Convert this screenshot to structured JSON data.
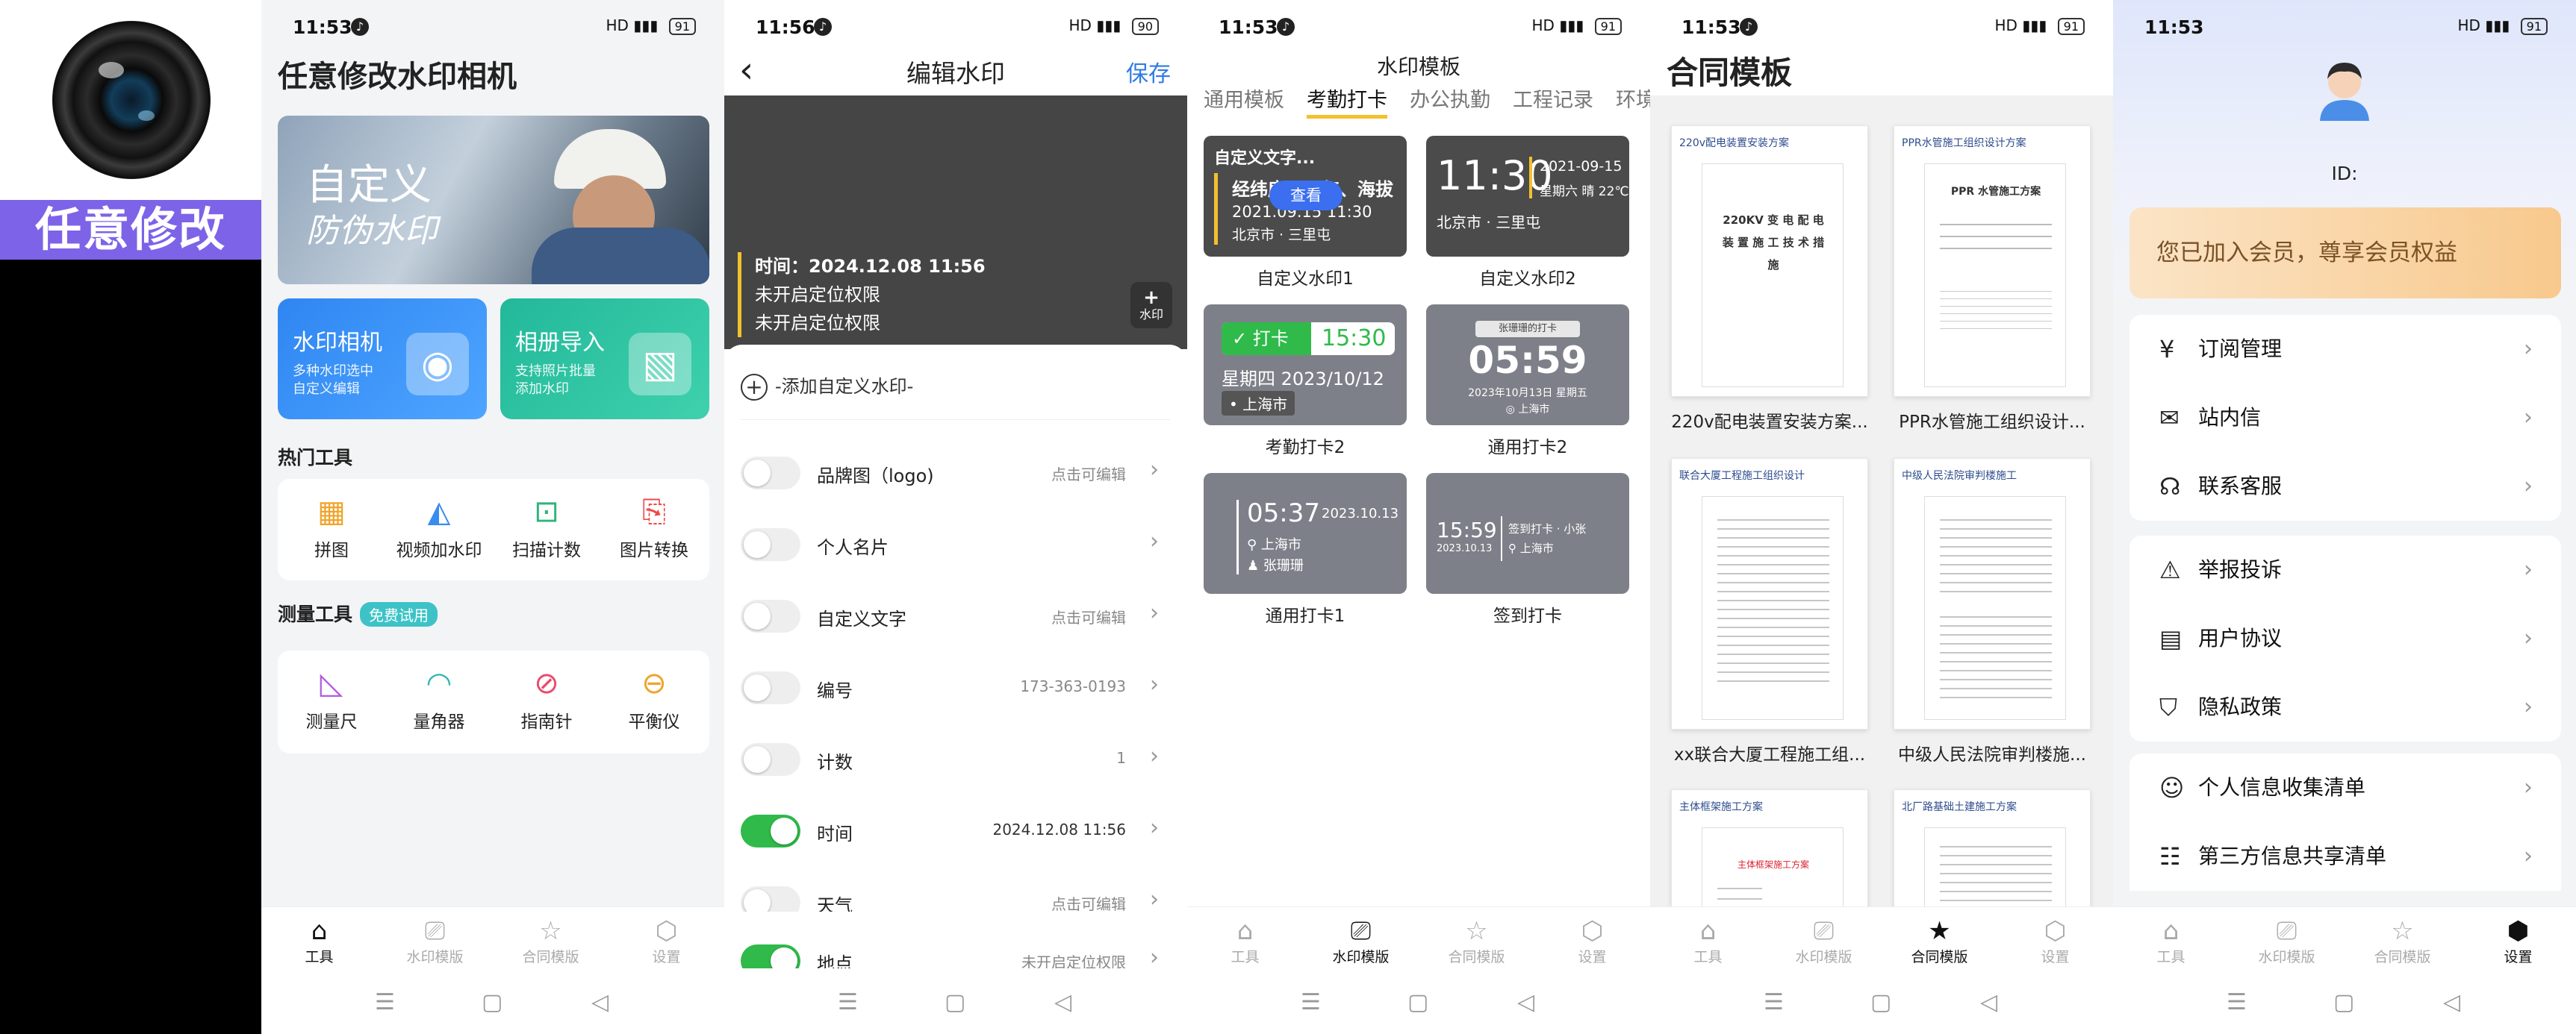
{
  "brand": {
    "title": "任意修改"
  },
  "status": {
    "p1": "11:53",
    "p2": "11:56",
    "p3": "11:53",
    "p4": "11:53",
    "p5": "11:53",
    "battery_91": "91",
    "battery_90": "90"
  },
  "tabs": {
    "tools": "工具",
    "watermark": "水印模版",
    "contract": "合同模版",
    "settings": "设置"
  },
  "nav": {
    "menu": "☰",
    "home": "▢",
    "back": "◁"
  },
  "p1": {
    "title": "任意修改水印相机",
    "banner_line1": "自定义",
    "banner_line2": "防伪水印",
    "card1": {
      "title": "水印相机",
      "sub1": "多种水印选中",
      "sub2": "自定义编辑"
    },
    "card2": {
      "title": "相册导入",
      "sub1": "支持照片批量",
      "sub2": "添加水印"
    },
    "hot_tools": "热门工具",
    "hot": [
      "拼图",
      "视频加水印",
      "扫描计数",
      "图片转换"
    ],
    "measure_tools": "测量工具",
    "free_trial": "免费试用",
    "measure": [
      "测量尺",
      "量角器",
      "指南针",
      "平衡仪"
    ]
  },
  "p2": {
    "title": "编辑水印",
    "save": "保存",
    "wm_time": "时间：2024.12.08 11:56",
    "wm_loc1": "未开启定位权限",
    "wm_loc2": "未开启定位权限",
    "add_wm": "水印",
    "add_custom": "-添加自定义水印-",
    "rows": [
      {
        "label": "品牌图（logo)",
        "value": "点击可编辑"
      },
      {
        "label": "个人名片",
        "value": ""
      },
      {
        "label": "自定义文字",
        "value": "点击可编辑"
      },
      {
        "label": "编号",
        "value": "173-363-0193"
      },
      {
        "label": "计数",
        "value": "1"
      },
      {
        "label": "时间",
        "value": "2024.12.08 11:56"
      },
      {
        "label": "天气",
        "value": "点击可编辑"
      },
      {
        "label": "地点",
        "value": "未开启定位权限"
      }
    ]
  },
  "p3": {
    "header": "水印模板",
    "tabs": [
      "通用模板",
      "考勤打卡",
      "办公执勤",
      "工程记录",
      "环境"
    ],
    "t1": {
      "head": "自定义文字...",
      "line1": "经纬度、天气、海拔",
      "line2": "2021.09.15  11:30",
      "line3": "北京市 · 三里屯",
      "view": "查看",
      "cap": "自定义水印1"
    },
    "t2": {
      "time": "11:30",
      "date": "2021-09-15",
      "day": "星期六 晴 22℃",
      "loc": "北京市 · 三里屯",
      "cap": "自定义水印2"
    },
    "t3": {
      "badge": "✓  打卡",
      "time": "15:30",
      "date": "星期四  2023/10/12",
      "loc": "上海市",
      "cap": "考勤打卡2"
    },
    "t4": {
      "tag": "张珊珊的打卡",
      "time": "05:59",
      "date": "2023年10月13日 星期五",
      "loc": "上海市",
      "cap": "通用打卡2"
    },
    "t5": {
      "time": "05:37",
      "date": "2023.10.13",
      "loc": "上海市",
      "name": "张珊珊",
      "cap": "通用打卡1"
    },
    "t6": {
      "time": "15:59",
      "date": "2023.10.13",
      "tag": "签到打卡 · 小张",
      "loc": "上海市",
      "cap": "签到打卡"
    }
  },
  "p4": {
    "title": "合同模板",
    "docs": [
      {
        "head": "220v配电装置安装方案",
        "page_title": "220KV 变 电 配 电 装 置 施 工 技 术 措 施",
        "cap": "220v配电装置安装方案..."
      },
      {
        "head": "PPR水管施工组织设计方案",
        "page_title": "PPR 水管施工方案",
        "cap": "PPR水管施工组织设计..."
      },
      {
        "head": "联合大厦工程施工组织设计",
        "page_title": "",
        "cap": "xx联合大厦工程施工组..."
      },
      {
        "head": "中级人民法院审判楼施工",
        "page_title": "",
        "cap": "中级人民法院审判楼施..."
      },
      {
        "head": "主体框架施工方案",
        "page_title": "主体框架施工方案",
        "cap": ""
      },
      {
        "head": "北厂路基础土建施工方案",
        "page_title": "",
        "cap": ""
      }
    ]
  },
  "p5": {
    "id": "ID:",
    "vip": "您已加入会员，尊享会员权益",
    "g1": [
      {
        "icon": "¥",
        "label": "订阅管理"
      },
      {
        "icon": "✉",
        "label": "站内信"
      },
      {
        "icon": "☊",
        "label": "联系客服"
      }
    ],
    "g2": [
      {
        "icon": "⚠",
        "label": "举报投诉"
      },
      {
        "icon": "▤",
        "label": "用户协议"
      },
      {
        "icon": "⛉",
        "label": "隐私政策"
      }
    ],
    "g3": [
      {
        "icon": "☺",
        "label": "个人信息收集清单"
      },
      {
        "icon": "☷",
        "label": "第三方信息共享清单"
      }
    ]
  }
}
